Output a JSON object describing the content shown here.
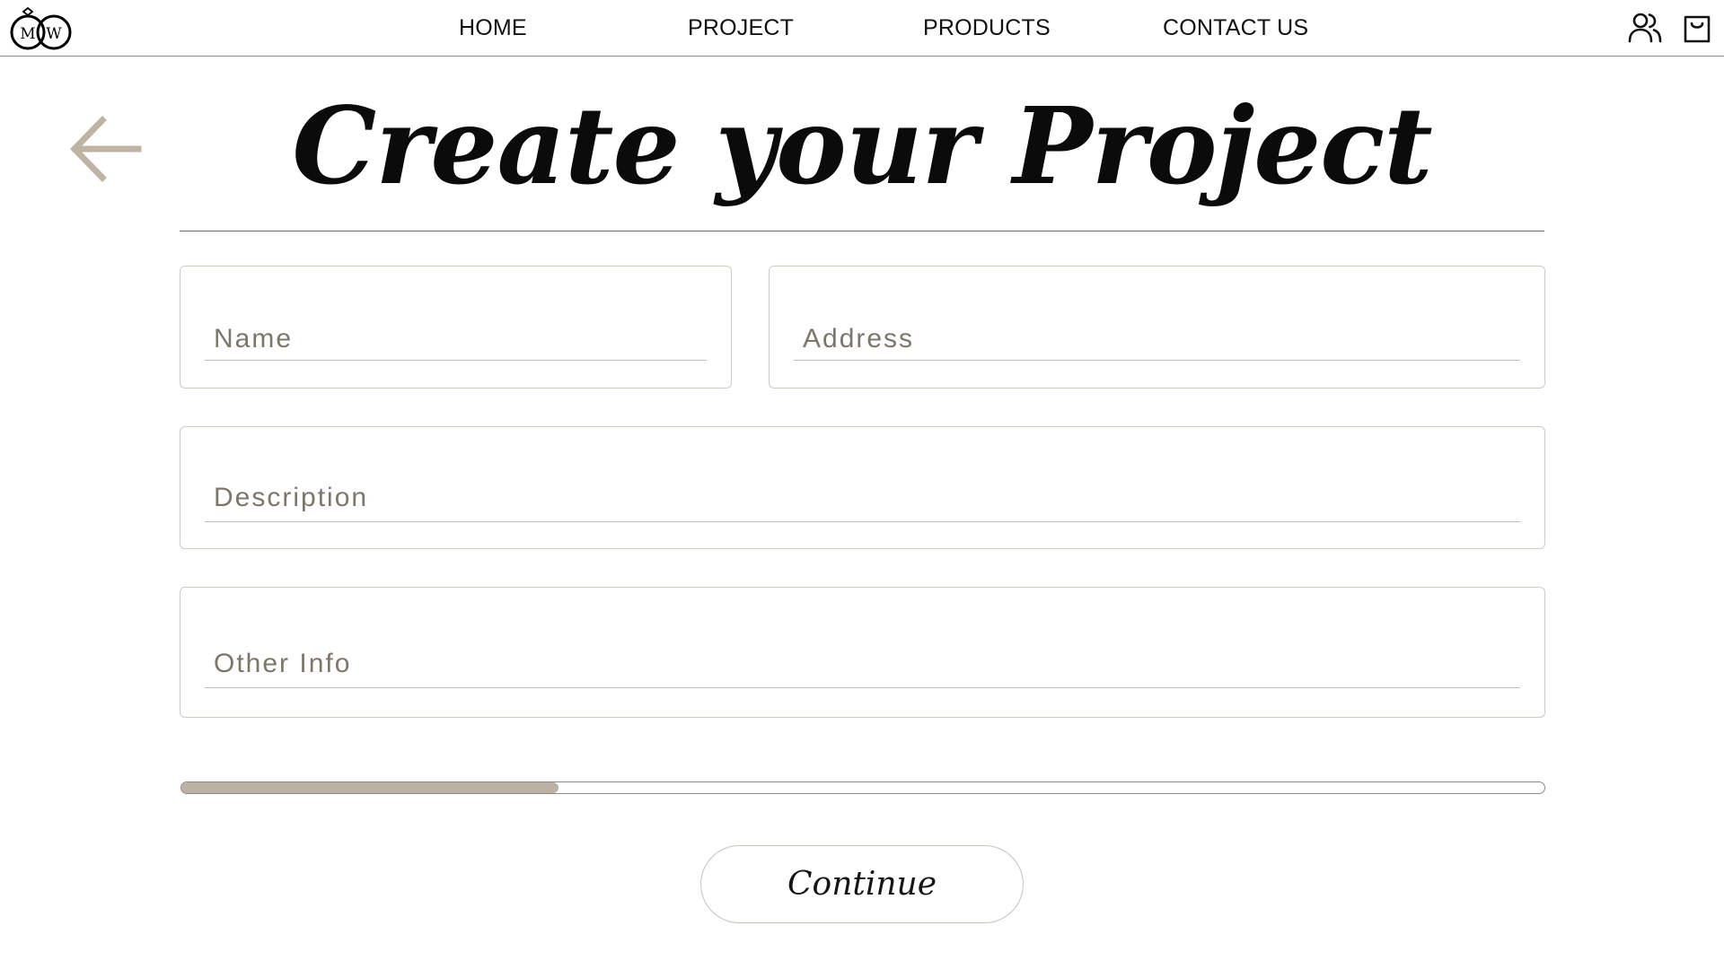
{
  "brand": {
    "logo_text": "MW",
    "logo_icon": "rings-logo-icon"
  },
  "nav": {
    "items": [
      {
        "label": "HOME"
      },
      {
        "label": "PROJECT"
      },
      {
        "label": "PRODUCTS"
      },
      {
        "label": "CONTACT US"
      }
    ]
  },
  "header_icons": {
    "account": "users-icon",
    "cart": "shopping-bag-icon"
  },
  "page": {
    "back_icon": "arrow-left-icon",
    "title": "Create your Project"
  },
  "form": {
    "name": {
      "placeholder": "Name",
      "value": ""
    },
    "address": {
      "placeholder": "Address",
      "value": ""
    },
    "description": {
      "placeholder": "Description",
      "value": ""
    },
    "other_info": {
      "placeholder": "Other Info",
      "value": ""
    }
  },
  "progress": {
    "fraction": 0.277
  },
  "continue_label": "Continue",
  "colors": {
    "accent": "#bcb2a3",
    "field_border": "#d2cbc0",
    "placeholder": "#7d7669",
    "text": "#111111"
  }
}
